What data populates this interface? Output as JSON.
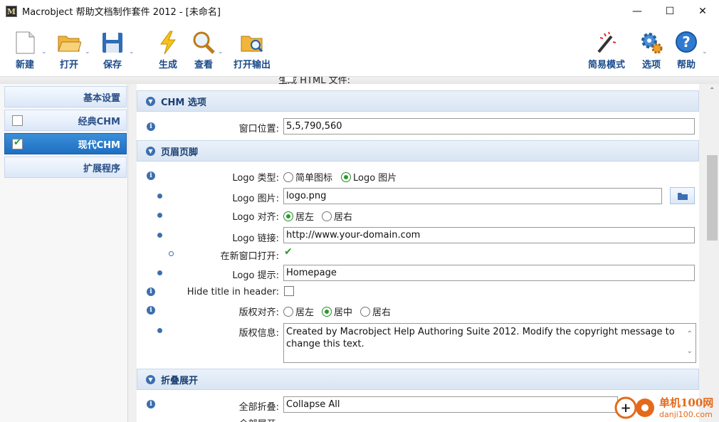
{
  "window": {
    "title": "Macrobject 帮助文档制作套件 2012 - [未命名]",
    "app_icon": "M"
  },
  "toolbar": {
    "new": "新建",
    "open": "打开",
    "save": "保存",
    "build": "生成",
    "view": "查看",
    "open_output": "打开输出",
    "easy_mode": "简易模式",
    "options": "选项",
    "help": "帮助"
  },
  "sidebar": {
    "items": [
      {
        "label": "基本设置"
      },
      {
        "label": "经典CHM",
        "checked": false
      },
      {
        "label": "现代CHM",
        "checked": true
      },
      {
        "label": "扩展程序"
      }
    ]
  },
  "form": {
    "cut_label": "生成 HTML 文件:",
    "chm_section": "CHM 选项",
    "window_pos_label": "窗口位置:",
    "window_pos_value": "5,5,790,560",
    "header_section": "页眉页脚",
    "logo_type_label": "Logo 类型:",
    "logo_type_opt1": "简单图标",
    "logo_type_opt2": "Logo 图片",
    "logo_image_label": "Logo 图片:",
    "logo_image_value": "logo.png",
    "logo_align_label": "Logo 对齐:",
    "align_left": "居左",
    "align_right": "居右",
    "align_center": "居中",
    "logo_link_label": "Logo 链接:",
    "logo_link_value": "http://www.your-domain.com",
    "new_window_label": "在新窗口打开:",
    "logo_tip_label": "Logo 提示:",
    "logo_tip_value": "Homepage",
    "hide_title_label": "Hide title in header:",
    "copyright_align_label": "版权对齐:",
    "copyright_info_label": "版权信息:",
    "copyright_info_value": "Created by Macrobject Help Authoring Suite 2012. Modify the copyright message to change this text.",
    "collapse_section": "折叠展开",
    "collapse_all_label": "全部折叠:",
    "collapse_all_value": "Collapse All",
    "expand_all_label": "全部展开:"
  },
  "watermark": {
    "site": "单机100网",
    "url": "danji100.com"
  }
}
